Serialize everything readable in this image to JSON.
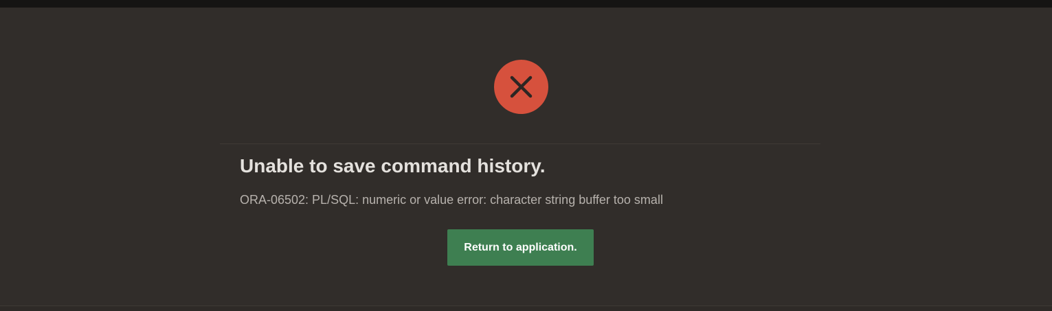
{
  "error": {
    "icon": "close-icon",
    "icon_color": "#d6513d",
    "title": "Unable to save command history.",
    "message": "ORA-06502: PL/SQL: numeric or value error: character string buffer too small"
  },
  "actions": {
    "return_label": "Return to application.",
    "return_color": "#3e7f51"
  },
  "theme": {
    "background": "#312d2a",
    "topbar": "#151413"
  }
}
